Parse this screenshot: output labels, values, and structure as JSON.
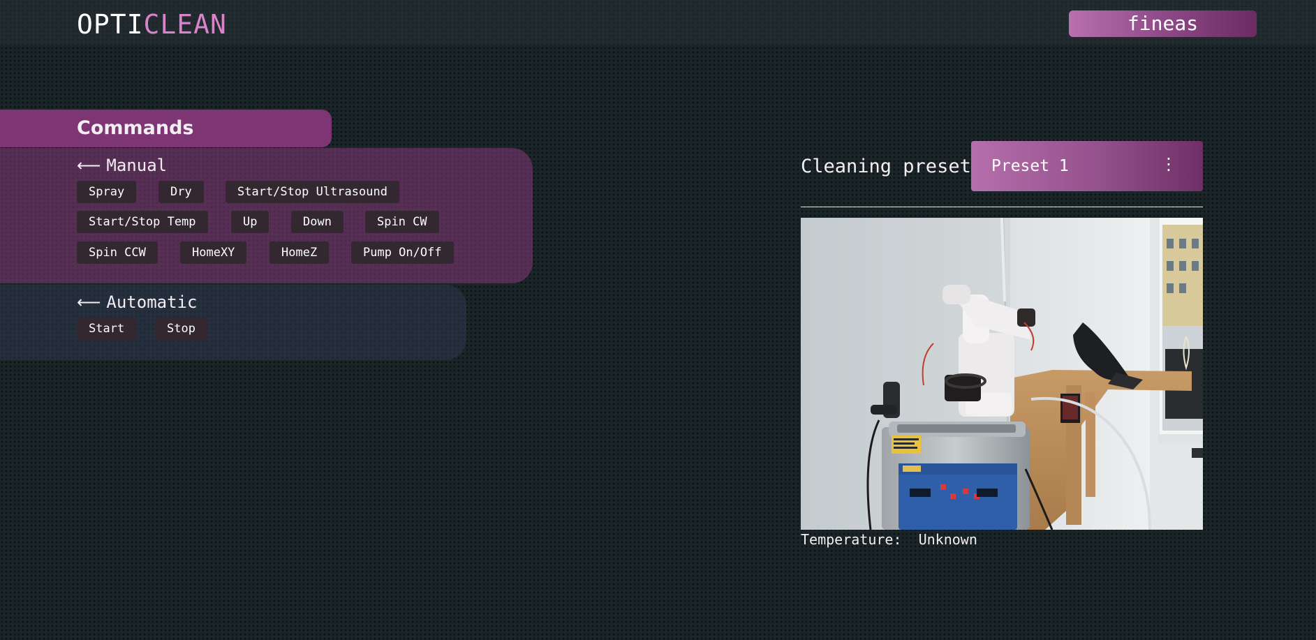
{
  "header": {
    "logo_part1": "OPTI",
    "logo_part2": "CLEAN",
    "user_label": "fineas"
  },
  "commands": {
    "title": "Commands",
    "manual": {
      "arrow": "⟵",
      "title": "Manual",
      "buttons": [
        "Spray",
        "Dry",
        "Start/Stop Ultrasound",
        "Start/Stop Temp",
        "Up",
        "Down",
        "Spin CW",
        "Spin CCW",
        "HomeXY",
        "HomeZ",
        "Pump On/Off"
      ]
    },
    "automatic": {
      "arrow": "⟵",
      "title": "Automatic",
      "buttons": [
        "Start",
        "Stop"
      ]
    }
  },
  "preset": {
    "label": "Cleaning preset",
    "selected": "Preset 1",
    "menu_icon": "⋮"
  },
  "status": {
    "temperature_label": "Temperature:",
    "temperature_value": "Unknown"
  },
  "colors": {
    "background": "#1b2629",
    "accent": "#d884c9",
    "manual_panel": "#7a3670",
    "button_bg": "#33282f"
  }
}
